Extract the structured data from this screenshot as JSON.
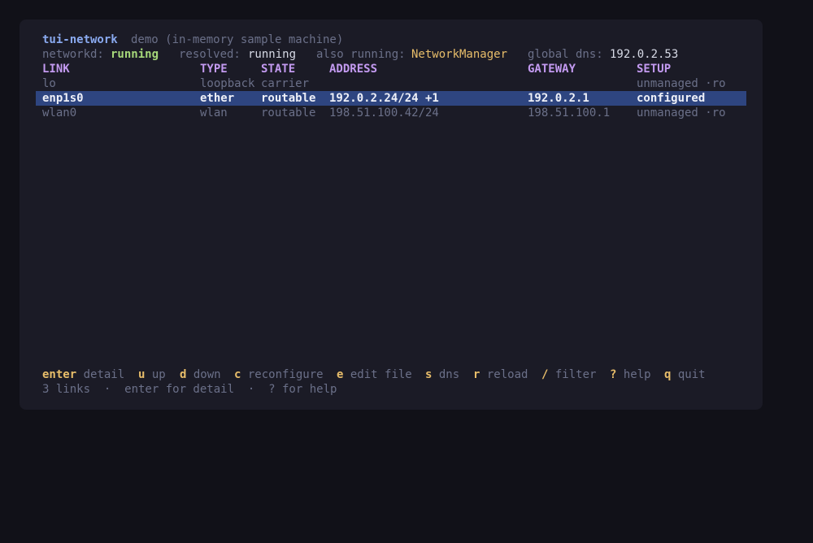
{
  "header": {
    "app_name": "tui-network",
    "subtitle": "demo (in-memory sample machine)"
  },
  "status": {
    "networkd_label": "networkd:",
    "networkd_value": "running",
    "resolved_label": "resolved:",
    "resolved_value": "running",
    "also_label": "also running:",
    "also_value": "NetworkManager",
    "dns_label": "global dns:",
    "dns_value": "192.0.2.53"
  },
  "table": {
    "columns": {
      "link": "LINK",
      "type": "TYPE",
      "state": "STATE",
      "address": "ADDRESS",
      "gateway": "GATEWAY",
      "setup": "SETUP"
    },
    "rows": [
      {
        "link": "lo",
        "type": "loopback",
        "state": "carrier",
        "address": "",
        "gateway": "",
        "setup": "unmanaged ·ro"
      },
      {
        "link": "enp1s0",
        "type": "ether",
        "state": "routable",
        "address": "192.0.2.24/24 +1",
        "gateway": "192.0.2.1",
        "setup": "configured"
      },
      {
        "link": "wlan0",
        "type": "wlan",
        "state": "routable",
        "address": "198.51.100.42/24",
        "gateway": "198.51.100.1",
        "setup": "unmanaged ·ro"
      }
    ]
  },
  "keybar": {
    "items": [
      {
        "key": "enter",
        "desc": "detail"
      },
      {
        "key": "u",
        "desc": "up"
      },
      {
        "key": "d",
        "desc": "down"
      },
      {
        "key": "c",
        "desc": "reconfigure"
      },
      {
        "key": "e",
        "desc": "edit file"
      },
      {
        "key": "s",
        "desc": "dns"
      },
      {
        "key": "r",
        "desc": "reload"
      },
      {
        "key": "/",
        "desc": "filter"
      },
      {
        "key": "?",
        "desc": "help"
      },
      {
        "key": "q",
        "desc": "quit"
      }
    ]
  },
  "footer": {
    "text": "3 links  ·  enter for detail  ·  ? for help"
  },
  "colors": {
    "background": "#111118",
    "panel": "#1b1b26",
    "selection": "#2e4580",
    "accent_blue": "#8aaaf0",
    "accent_green": "#a6d87a",
    "accent_yellow": "#e7bd6a",
    "accent_purple": "#c39af0",
    "dim": "#6b7089"
  }
}
